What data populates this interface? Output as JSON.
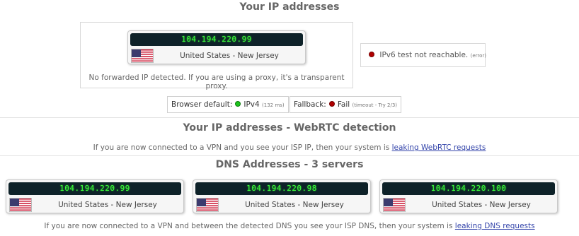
{
  "ip_section": {
    "title": "Your IP addresses",
    "ip": "104.194.220.99",
    "location": "United States - New Jersey",
    "forwarded_note": "No forwarded IP detected. If you are using a proxy, it's a transparent proxy.",
    "ipv6_text": "IPv6 test not reachable.",
    "ipv6_small": "(error)"
  },
  "protocol": {
    "browser_default_label": "Browser default:",
    "browser_default_value": "IPv4",
    "browser_default_small": "(132 ms)",
    "fallback_label": "Fallback:",
    "fallback_value": "Fail",
    "fallback_small": "(timeout - Try 2/3)"
  },
  "webrtc": {
    "title": "Your IP addresses - WebRTC detection",
    "note": "If you are now connected to a VPN and you see your ISP IP, then your system is",
    "link": "leaking WebRTC requests"
  },
  "dns": {
    "title": "DNS Addresses - 3 servers",
    "servers": [
      {
        "ip": "104.194.220.99",
        "location": "United States - New Jersey"
      },
      {
        "ip": "104.194.220.98",
        "location": "United States - New Jersey"
      },
      {
        "ip": "104.194.220.100",
        "location": "United States - New Jersey"
      }
    ],
    "note": "If you are now connected to a VPN and between the detected DNS you see your ISP DNS, then your system is",
    "link": "leaking DNS requests"
  },
  "colors": {
    "ip_bar_bg": "#0e2229",
    "ip_text": "#3dff3d",
    "link": "#3344aa",
    "status_ok": "#1dc41d",
    "status_fail": "#b00000"
  },
  "icons": [
    "us-flag-icon",
    "status-dot-icon"
  ]
}
